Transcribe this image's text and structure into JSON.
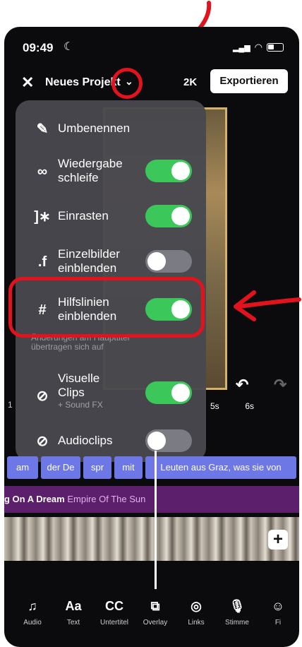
{
  "status": {
    "time": "09:49"
  },
  "top_bar": {
    "project_title": "Neues Projekt",
    "resolution": "2K",
    "export_label": "Exportieren"
  },
  "menu": {
    "items": [
      {
        "label": "Umbenennen",
        "icon": "pencil-icon"
      },
      {
        "label_line1": "Wiedergabe",
        "label_line2": "schleife",
        "toggle": true,
        "icon": "loop-icon"
      },
      {
        "label": "Einrasten",
        "toggle": true,
        "icon": "snap-icon"
      },
      {
        "label_line1": "Einzelbilder",
        "label_line2": "einblenden",
        "toggle": false,
        "icon": "frames-icon"
      },
      {
        "label_line1": "Hilfslinien",
        "label_line2": "einblenden",
        "toggle": true,
        "icon": "grid-icon"
      },
      {
        "label_line1": "Visuelle",
        "label_line2": "Clips",
        "sub": "+ Sound FX",
        "toggle": true,
        "icon": "link-icon"
      },
      {
        "label": "Audioclips",
        "toggle": false,
        "icon": "link-icon"
      }
    ],
    "hint": "Änderungen am Haupttitel übertragen sich auf"
  },
  "timeline": {
    "marks": [
      "1",
      "5s",
      "6s"
    ],
    "subtitle_clips": [
      "am",
      "der De",
      "spr",
      "mit",
      "Leuten aus Graz, was sie von"
    ],
    "music_title": "g On A Dream",
    "music_artist": "Empire Of The Sun"
  },
  "tools": [
    {
      "label": "Audio",
      "glyph": "♫"
    },
    {
      "label": "Text",
      "glyph": "Aa"
    },
    {
      "label": "Untertitel",
      "glyph": "CC"
    },
    {
      "label": "Overlay",
      "glyph": "⧉"
    },
    {
      "label": "Links",
      "glyph": "◎"
    },
    {
      "label": "Stimme",
      "glyph": "🎙"
    },
    {
      "label": "Fi",
      "glyph": "☺"
    }
  ],
  "colors": {
    "toggle_on": "#3cc75a",
    "annotation_red": "#e3131d",
    "subtitle_clip": "#6d78e6",
    "music_track": "#5b1f6b"
  }
}
